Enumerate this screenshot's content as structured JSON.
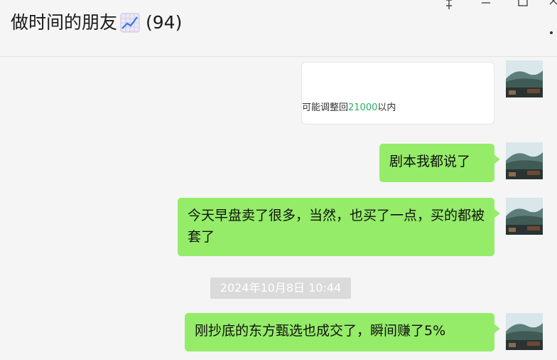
{
  "header": {
    "title": "做时间的朋友",
    "title_emoji": "chart-increasing-icon",
    "member_count": "(94)"
  },
  "messages": {
    "card": {
      "text_before": "可能调整回",
      "highlight": "21000",
      "text_after": "以内",
      "highlight_color": "#2aae67"
    },
    "msg1": "剧本我都说了",
    "msg2": "今天早盘卖了很多，当然，也买了一点，买的都被套了",
    "timestamp": "2024年10月8日 10:44",
    "msg3": "刚抄底的东方甄选也成交了，瞬间赚了5%"
  },
  "colors": {
    "bubble": "#95ec69",
    "background": "#f5f5f5"
  }
}
